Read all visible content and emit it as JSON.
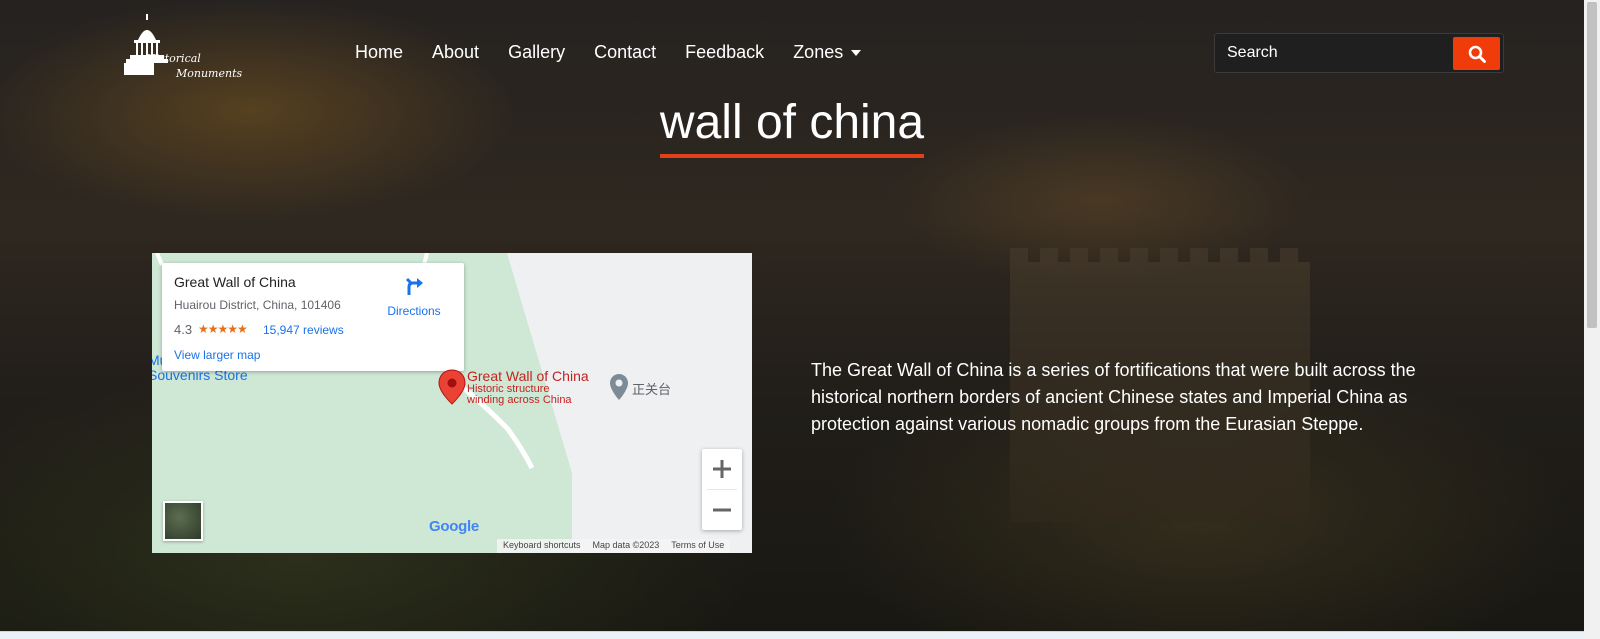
{
  "logo": {
    "alt": "Historical Monuments",
    "icon": "capitol-dome-icon"
  },
  "nav": {
    "items": [
      {
        "label": "Home"
      },
      {
        "label": "About"
      },
      {
        "label": "Gallery"
      },
      {
        "label": "Contact"
      },
      {
        "label": "Feedback"
      },
      {
        "label": "Zones",
        "has_dropdown": true
      }
    ]
  },
  "search": {
    "placeholder": "Search",
    "button_icon": "search-icon",
    "button_color": "#f03c0a"
  },
  "page": {
    "title": "wall of china",
    "underline_color": "#e0401a"
  },
  "map": {
    "place_name": "Great Wall of China",
    "address": "Huairou District, China, 101406",
    "rating": "4.3",
    "stars": "★★★★★",
    "reviews": "15,947 reviews",
    "directions": "Directions",
    "view_larger": "View larger map",
    "pin_title": "Great Wall of China",
    "pin_sub1": "Historic structure",
    "pin_sub2": "winding across China",
    "nearby_place": "正关台",
    "souvenir_line1": "Mu",
    "souvenir_line2": "Souvenirs Store",
    "google": "Google",
    "attrib_keyboard": "Keyboard shortcuts",
    "attrib_mapdata": "Map data ©2023",
    "attrib_terms": "Terms of Use"
  },
  "description": "The Great Wall of China is a series of fortifications that were built across the historical northern borders of ancient Chinese states and Imperial China as protection against various nomadic groups from the Eurasian Steppe."
}
